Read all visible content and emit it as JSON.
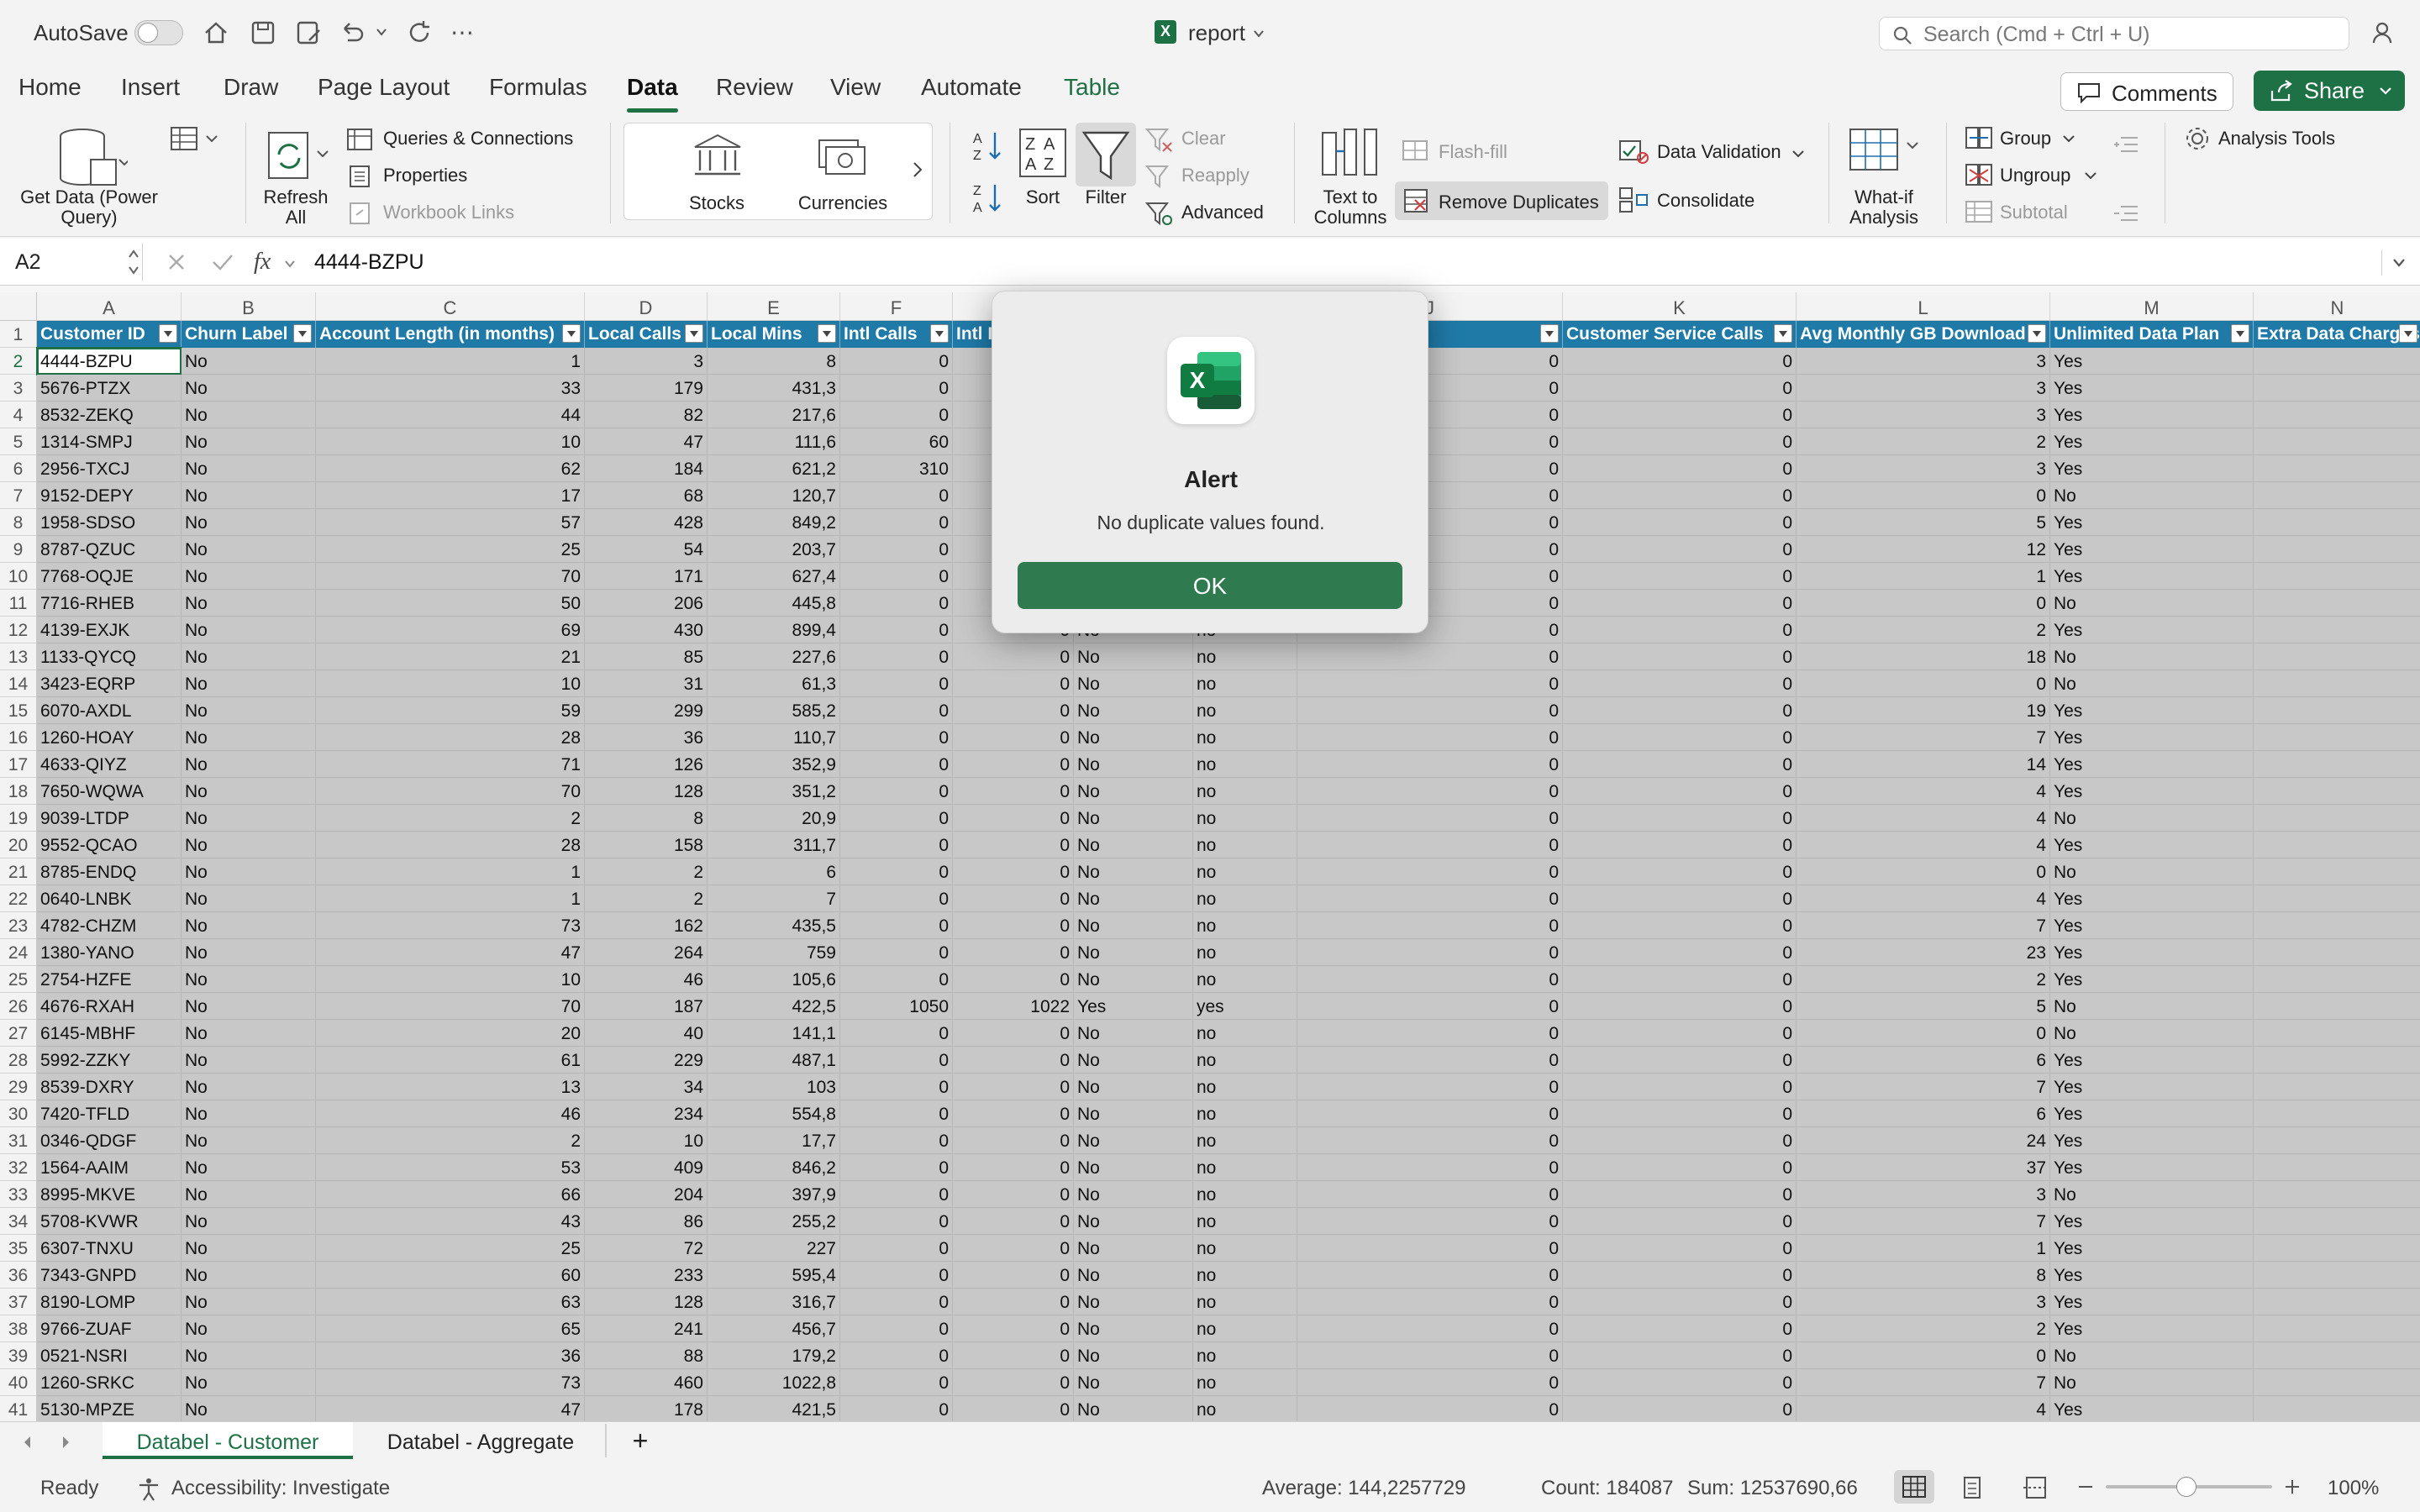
{
  "titlebar": {
    "autosave_label": "AutoSave",
    "file_name": "report",
    "search_placeholder": "Search (Cmd + Ctrl + U)"
  },
  "tabs": [
    "Home",
    "Insert",
    "Draw",
    "Page Layout",
    "Formulas",
    "Data",
    "Review",
    "View",
    "Automate",
    "Table"
  ],
  "active_tab": "Data",
  "header_buttons": {
    "comments": "Comments",
    "share": "Share"
  },
  "ribbon": {
    "get_data_1": "Get Data (Power",
    "get_data_2": "Query)",
    "refresh_1": "Refresh",
    "refresh_2": "All",
    "queries": "Queries & Connections",
    "properties": "Properties",
    "workbook_links": "Workbook Links",
    "stocks": "Stocks",
    "currencies": "Currencies",
    "sort": "Sort",
    "filter": "Filter",
    "clear": "Clear",
    "reapply": "Reapply",
    "advanced": "Advanced",
    "text_to_columns_1": "Text to",
    "text_to_columns_2": "Columns",
    "flash_fill": "Flash-fill",
    "remove_duplicates": "Remove Duplicates",
    "data_validation": "Data Validation",
    "consolidate": "Consolidate",
    "what_if_1": "What-if",
    "what_if_2": "Analysis",
    "group": "Group",
    "ungroup": "Ungroup",
    "subtotal": "Subtotal",
    "analysis_tools": "Analysis Tools"
  },
  "formula_bar": {
    "name_box": "A2",
    "fx": "fx",
    "value": "4444-BZPU"
  },
  "columns": [
    "A",
    "B",
    "C",
    "D",
    "E",
    "F",
    "",
    "",
    "",
    "J",
    "K",
    "L",
    "M",
    "N"
  ],
  "table_headers": [
    "Customer ID",
    "Churn Label",
    "Account Length (in months)",
    "Local Calls",
    "Local Mins",
    "Intl Calls",
    "Intl I",
    "",
    "",
    "nal Charges",
    "Customer Service Calls",
    "Avg Monthly GB Download",
    "Unlimited Data Plan",
    "Extra Data Charges"
  ],
  "rows": [
    [
      "4444-BZPU",
      "No",
      "1",
      "3",
      "8",
      "0",
      "",
      "",
      "",
      "0",
      "0",
      "3",
      "Yes",
      ""
    ],
    [
      "5676-PTZX",
      "No",
      "33",
      "179",
      "431,3",
      "0",
      "",
      "",
      "",
      "0",
      "0",
      "3",
      "Yes",
      ""
    ],
    [
      "8532-ZEKQ",
      "No",
      "44",
      "82",
      "217,6",
      "0",
      "",
      "",
      "",
      "0",
      "0",
      "3",
      "Yes",
      ""
    ],
    [
      "1314-SMPJ",
      "No",
      "10",
      "47",
      "111,6",
      "60",
      "",
      "",
      "",
      "0",
      "0",
      "2",
      "Yes",
      ""
    ],
    [
      "2956-TXCJ",
      "No",
      "62",
      "184",
      "621,2",
      "310",
      "",
      "",
      "",
      "0",
      "0",
      "3",
      "Yes",
      ""
    ],
    [
      "9152-DEPY",
      "No",
      "17",
      "68",
      "120,7",
      "0",
      "",
      "",
      "",
      "0",
      "0",
      "0",
      "No",
      ""
    ],
    [
      "1958-SDSO",
      "No",
      "57",
      "428",
      "849,2",
      "0",
      "",
      "",
      "",
      "0",
      "0",
      "5",
      "Yes",
      ""
    ],
    [
      "8787-QZUC",
      "No",
      "25",
      "54",
      "203,7",
      "0",
      "",
      "",
      "",
      "0",
      "0",
      "12",
      "Yes",
      ""
    ],
    [
      "7768-OQJE",
      "No",
      "70",
      "171",
      "627,4",
      "0",
      "",
      "",
      "",
      "0",
      "0",
      "1",
      "Yes",
      ""
    ],
    [
      "7716-RHEB",
      "No",
      "50",
      "206",
      "445,8",
      "0",
      "",
      "",
      "",
      "0",
      "0",
      "0",
      "No",
      ""
    ],
    [
      "4139-EXJK",
      "No",
      "69",
      "430",
      "899,4",
      "0",
      "0",
      "No",
      "no",
      "0",
      "0",
      "2",
      "Yes",
      ""
    ],
    [
      "1133-QYCQ",
      "No",
      "21",
      "85",
      "227,6",
      "0",
      "0",
      "No",
      "no",
      "0",
      "0",
      "18",
      "No",
      ""
    ],
    [
      "3423-EQRP",
      "No",
      "10",
      "31",
      "61,3",
      "0",
      "0",
      "No",
      "no",
      "0",
      "0",
      "0",
      "No",
      ""
    ],
    [
      "6070-AXDL",
      "No",
      "59",
      "299",
      "585,2",
      "0",
      "0",
      "No",
      "no",
      "0",
      "0",
      "19",
      "Yes",
      ""
    ],
    [
      "1260-HOAY",
      "No",
      "28",
      "36",
      "110,7",
      "0",
      "0",
      "No",
      "no",
      "0",
      "0",
      "7",
      "Yes",
      ""
    ],
    [
      "4633-QIYZ",
      "No",
      "71",
      "126",
      "352,9",
      "0",
      "0",
      "No",
      "no",
      "0",
      "0",
      "14",
      "Yes",
      ""
    ],
    [
      "7650-WQWA",
      "No",
      "70",
      "128",
      "351,2",
      "0",
      "0",
      "No",
      "no",
      "0",
      "0",
      "4",
      "Yes",
      ""
    ],
    [
      "9039-LTDP",
      "No",
      "2",
      "8",
      "20,9",
      "0",
      "0",
      "No",
      "no",
      "0",
      "0",
      "4",
      "No",
      ""
    ],
    [
      "9552-QCAO",
      "No",
      "28",
      "158",
      "311,7",
      "0",
      "0",
      "No",
      "no",
      "0",
      "0",
      "4",
      "Yes",
      ""
    ],
    [
      "8785-ENDQ",
      "No",
      "1",
      "2",
      "6",
      "0",
      "0",
      "No",
      "no",
      "0",
      "0",
      "0",
      "No",
      ""
    ],
    [
      "0640-LNBK",
      "No",
      "1",
      "2",
      "7",
      "0",
      "0",
      "No",
      "no",
      "0",
      "0",
      "4",
      "Yes",
      ""
    ],
    [
      "4782-CHZM",
      "No",
      "73",
      "162",
      "435,5",
      "0",
      "0",
      "No",
      "no",
      "0",
      "0",
      "7",
      "Yes",
      ""
    ],
    [
      "1380-YANO",
      "No",
      "47",
      "264",
      "759",
      "0",
      "0",
      "No",
      "no",
      "0",
      "0",
      "23",
      "Yes",
      ""
    ],
    [
      "2754-HZFE",
      "No",
      "10",
      "46",
      "105,6",
      "0",
      "0",
      "No",
      "no",
      "0",
      "0",
      "2",
      "Yes",
      ""
    ],
    [
      "4676-RXAH",
      "No",
      "70",
      "187",
      "422,5",
      "1050",
      "1022",
      "Yes",
      "yes",
      "0",
      "0",
      "5",
      "No",
      ""
    ],
    [
      "6145-MBHF",
      "No",
      "20",
      "40",
      "141,1",
      "0",
      "0",
      "No",
      "no",
      "0",
      "0",
      "0",
      "No",
      ""
    ],
    [
      "5992-ZZKY",
      "No",
      "61",
      "229",
      "487,1",
      "0",
      "0",
      "No",
      "no",
      "0",
      "0",
      "6",
      "Yes",
      ""
    ],
    [
      "8539-DXRY",
      "No",
      "13",
      "34",
      "103",
      "0",
      "0",
      "No",
      "no",
      "0",
      "0",
      "7",
      "Yes",
      ""
    ],
    [
      "7420-TFLD",
      "No",
      "46",
      "234",
      "554,8",
      "0",
      "0",
      "No",
      "no",
      "0",
      "0",
      "6",
      "Yes",
      ""
    ],
    [
      "0346-QDGF",
      "No",
      "2",
      "10",
      "17,7",
      "0",
      "0",
      "No",
      "no",
      "0",
      "0",
      "24",
      "Yes",
      ""
    ],
    [
      "1564-AAIM",
      "No",
      "53",
      "409",
      "846,2",
      "0",
      "0",
      "No",
      "no",
      "0",
      "0",
      "37",
      "Yes",
      ""
    ],
    [
      "8995-MKVE",
      "No",
      "66",
      "204",
      "397,9",
      "0",
      "0",
      "No",
      "no",
      "0",
      "0",
      "3",
      "No",
      ""
    ],
    [
      "5708-KVWR",
      "No",
      "43",
      "86",
      "255,2",
      "0",
      "0",
      "No",
      "no",
      "0",
      "0",
      "7",
      "Yes",
      ""
    ],
    [
      "6307-TNXU",
      "No",
      "25",
      "72",
      "227",
      "0",
      "0",
      "No",
      "no",
      "0",
      "0",
      "1",
      "Yes",
      ""
    ],
    [
      "7343-GNPD",
      "No",
      "60",
      "233",
      "595,4",
      "0",
      "0",
      "No",
      "no",
      "0",
      "0",
      "8",
      "Yes",
      ""
    ],
    [
      "8190-LOMP",
      "No",
      "63",
      "128",
      "316,7",
      "0",
      "0",
      "No",
      "no",
      "0",
      "0",
      "3",
      "Yes",
      ""
    ],
    [
      "9766-ZUAF",
      "No",
      "65",
      "241",
      "456,7",
      "0",
      "0",
      "No",
      "no",
      "0",
      "0",
      "2",
      "Yes",
      ""
    ],
    [
      "0521-NSRI",
      "No",
      "36",
      "88",
      "179,2",
      "0",
      "0",
      "No",
      "no",
      "0",
      "0",
      "0",
      "No",
      ""
    ],
    [
      "1260-SRKC",
      "No",
      "73",
      "460",
      "1022,8",
      "0",
      "0",
      "No",
      "no",
      "0",
      "0",
      "7",
      "No",
      ""
    ],
    [
      "5130-MPZE",
      "No",
      "47",
      "178",
      "421,5",
      "0",
      "0",
      "No",
      "no",
      "0",
      "0",
      "4",
      "Yes",
      ""
    ]
  ],
  "sheets": [
    "Databel - Customer",
    "Databel - Aggregate"
  ],
  "add_sheet": "+",
  "status": {
    "ready": "Ready",
    "accessibility": "Accessibility: Investigate",
    "average": "Average: 144,2257729",
    "count": "Count: 184087",
    "sum": "Sum: 12537690,66",
    "zoom": "100%"
  },
  "alert": {
    "title": "Alert",
    "message": "No duplicate values found.",
    "ok": "OK"
  },
  "colors": {
    "accent": "#1e7145",
    "table_header": "#1f7aa8"
  }
}
